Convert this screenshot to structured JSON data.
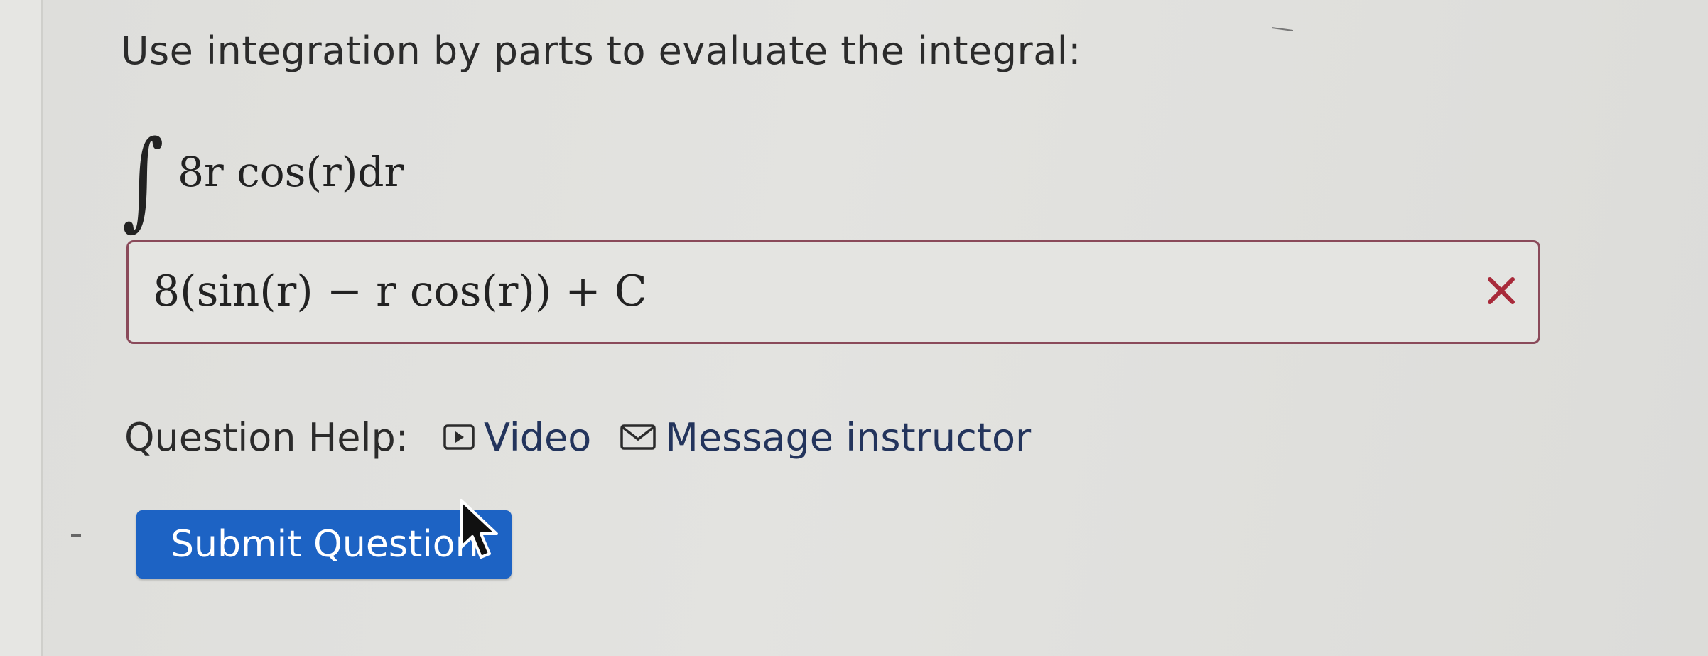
{
  "question": {
    "prompt": "Use integration by parts to evaluate the integral:",
    "integral_sign": "∫",
    "integrand": "8r cos(r)dr"
  },
  "answer": {
    "value": "8(sin(r) − r cos(r)) + C",
    "status_icon": "x-mark-icon",
    "status_color": "#a82a3a"
  },
  "help": {
    "label": "Question Help:",
    "video_label": "Video",
    "message_label": "Message instructor",
    "link_color": "#23345c"
  },
  "submit": {
    "label": "Submit Question",
    "color": "#1d63c4"
  }
}
